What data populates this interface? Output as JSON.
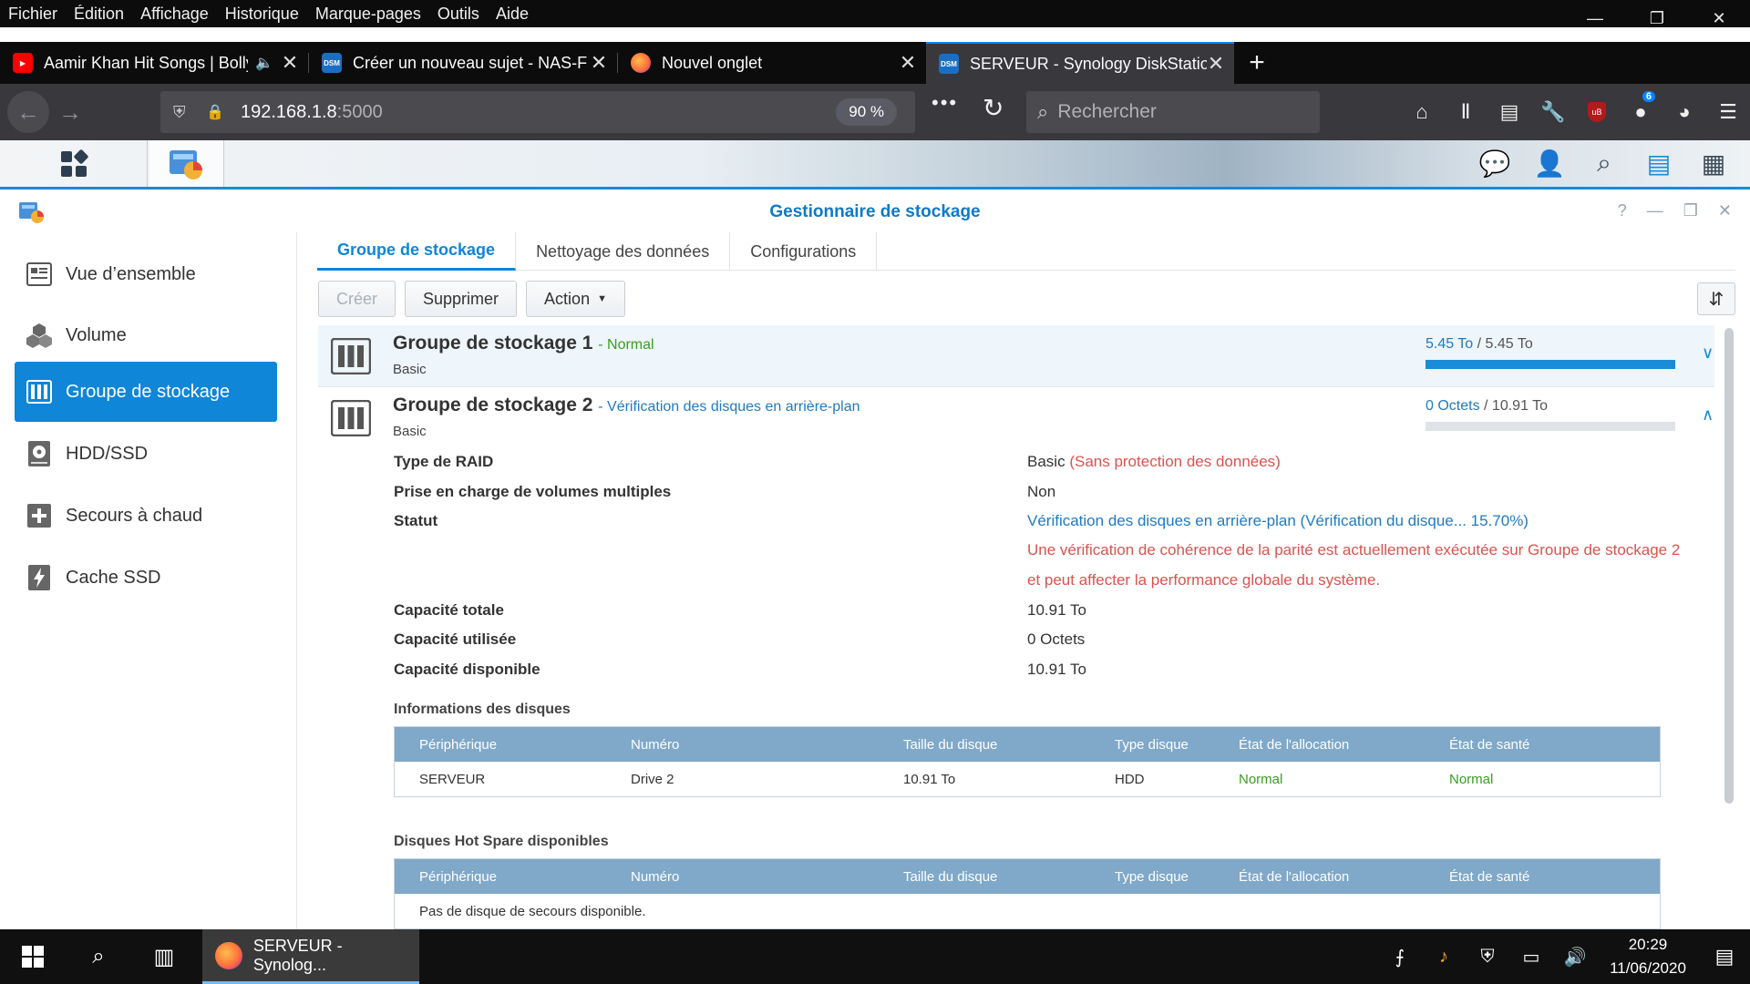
{
  "browser": {
    "menu": [
      "Fichier",
      "Édition",
      "Affichage",
      "Historique",
      "Marque-pages",
      "Outils",
      "Aide"
    ],
    "tabs": [
      {
        "label": "Aamir Khan Hit Songs | Bolly",
        "favicon_color": "#ff0000"
      },
      {
        "label": "Créer un nouveau sujet - NAS-F",
        "favicon_color": "#1a6fc4",
        "favicon_text": "DSM"
      },
      {
        "label": "Nouvel onglet",
        "favicon_color": "#ff7139"
      },
      {
        "label": "SERVEUR - Synology DiskStation",
        "favicon_color": "#1a6fc4",
        "favicon_text": "DSM"
      }
    ],
    "url_host": "192.168.1.8",
    "url_port": ":5000",
    "zoom": "90 %",
    "search_placeholder": "Rechercher",
    "addon_badge": "6"
  },
  "window": {
    "title": "Gestionnaire de stockage"
  },
  "sidebar": {
    "items": [
      {
        "label": "Vue d’ensemble",
        "icon": "overview-icon"
      },
      {
        "label": "Volume",
        "icon": "volume-icon"
      },
      {
        "label": "Groupe de stockage",
        "icon": "storage-pool-icon",
        "active": true
      },
      {
        "label": "HDD/SSD",
        "icon": "hdd-icon"
      },
      {
        "label": "Secours à chaud",
        "icon": "hot-spare-icon"
      },
      {
        "label": "Cache SSD",
        "icon": "ssd-cache-icon"
      }
    ]
  },
  "tabs": [
    "Groupe de stockage",
    "Nettoyage des données",
    "Configurations"
  ],
  "actions": {
    "create": "Créer",
    "delete": "Supprimer",
    "action": "Action"
  },
  "pools": [
    {
      "name": "Groupe de stockage 1",
      "status": "- Normal",
      "type": "Basic",
      "used": "5.45 To",
      "separator": " / ",
      "total": "5.45 To",
      "usage_fraction": 1.0
    },
    {
      "name": "Groupe de stockage 2",
      "status": "- Vérification des disques en arrière-plan",
      "type": "Basic",
      "used": "0 Octets",
      "separator": " / ",
      "total": "10.91 To",
      "usage_fraction": 0.0
    }
  ],
  "details": {
    "raid_label": "Type de RAID",
    "raid_value": "Basic",
    "raid_note": "(Sans protection des données)",
    "multi_label": "Prise en charge de volumes multiples",
    "multi_value": "Non",
    "status_label": "Statut",
    "status_value": "Vérification des disques en arrière-plan (Vérification du disque... 15.70%)",
    "warning": "Une vérification de cohérence de la parité est actuellement exécutée sur Groupe de stockage 2 et peut affecter la performance globale du système.",
    "total_label": "Capacité totale",
    "total_value": "10.91 To",
    "used_label": "Capacité utilisée",
    "used_value": "0 Octets",
    "free_label": "Capacité disponible",
    "free_value": "10.91 To"
  },
  "disk_info": {
    "title": "Informations des disques",
    "headers": [
      "Périphérique",
      "Numéro",
      "Taille du disque",
      "Type disque",
      "État de l'allocation",
      "État de santé"
    ],
    "rows": [
      [
        "SERVEUR",
        "Drive 2",
        "10.91 To",
        "HDD",
        "Normal",
        "Normal"
      ]
    ]
  },
  "hot_spare": {
    "title": "Disques Hot Spare disponibles",
    "headers": [
      "Périphérique",
      "Numéro",
      "Taille du disque",
      "Type disque",
      "État de l'allocation",
      "État de santé"
    ],
    "empty": "Pas de disque de secours disponible."
  },
  "taskbar": {
    "app_label": "SERVEUR - Synolog...",
    "time": "20:29",
    "date": "11/06/2020"
  }
}
